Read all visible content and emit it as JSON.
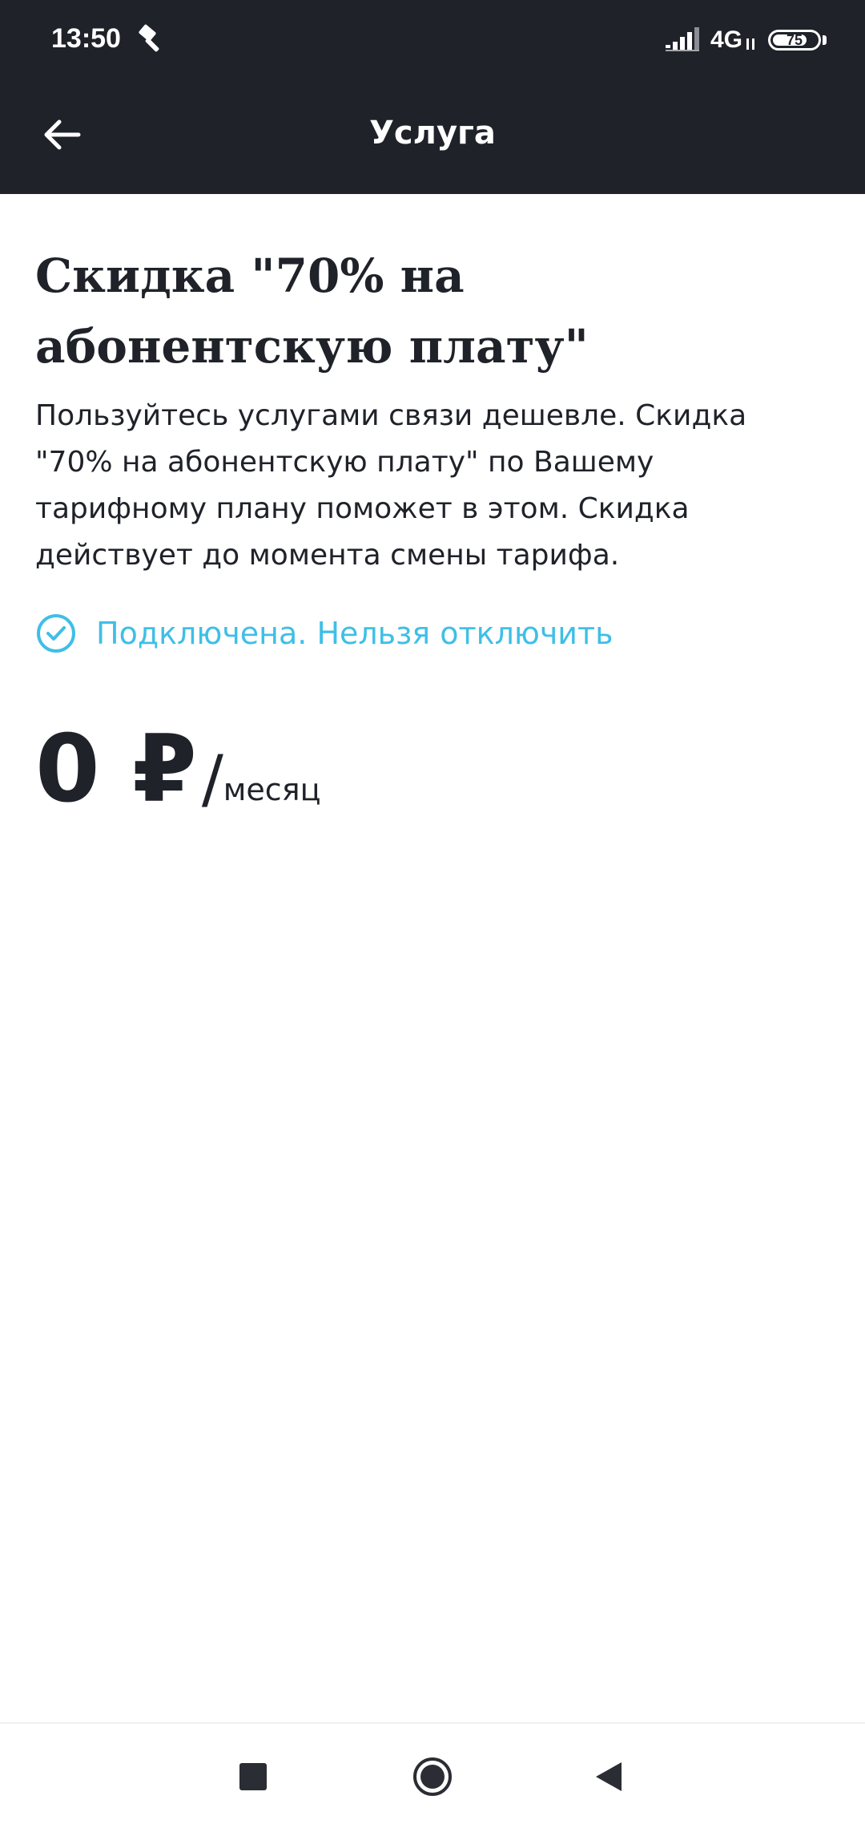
{
  "status_bar": {
    "time": "13:50",
    "network": "4G",
    "battery": "75",
    "icons": [
      "hammer-icon",
      "signal-icon",
      "data-arrows-icon",
      "battery-icon"
    ]
  },
  "app_bar": {
    "title": "Услуга",
    "back_icon": "arrow-left-icon"
  },
  "service": {
    "title": "Скидка \"70% на абонентскую плату\"",
    "description": "Пользуйтесь услугами связи дешевле. Скидка \"70% на абонентскую плату\" по Вашему тарифному плану поможет в этом. Скидка действует до момента смены тарифа.",
    "status": "Подключена. Нельзя отключить",
    "status_icon": "check-circle-icon",
    "status_color": "#3fbfe6"
  },
  "price": {
    "amount": "0 ₽",
    "slash": "/",
    "period": "месяц"
  },
  "nav_bar": {
    "icons": [
      "recents-square-icon",
      "home-circle-icon",
      "back-triangle-icon"
    ]
  },
  "colors": {
    "header_bg": "#1f2229",
    "accent": "#3fbfe6",
    "text": "#1f2229",
    "background": "#ffffff"
  }
}
